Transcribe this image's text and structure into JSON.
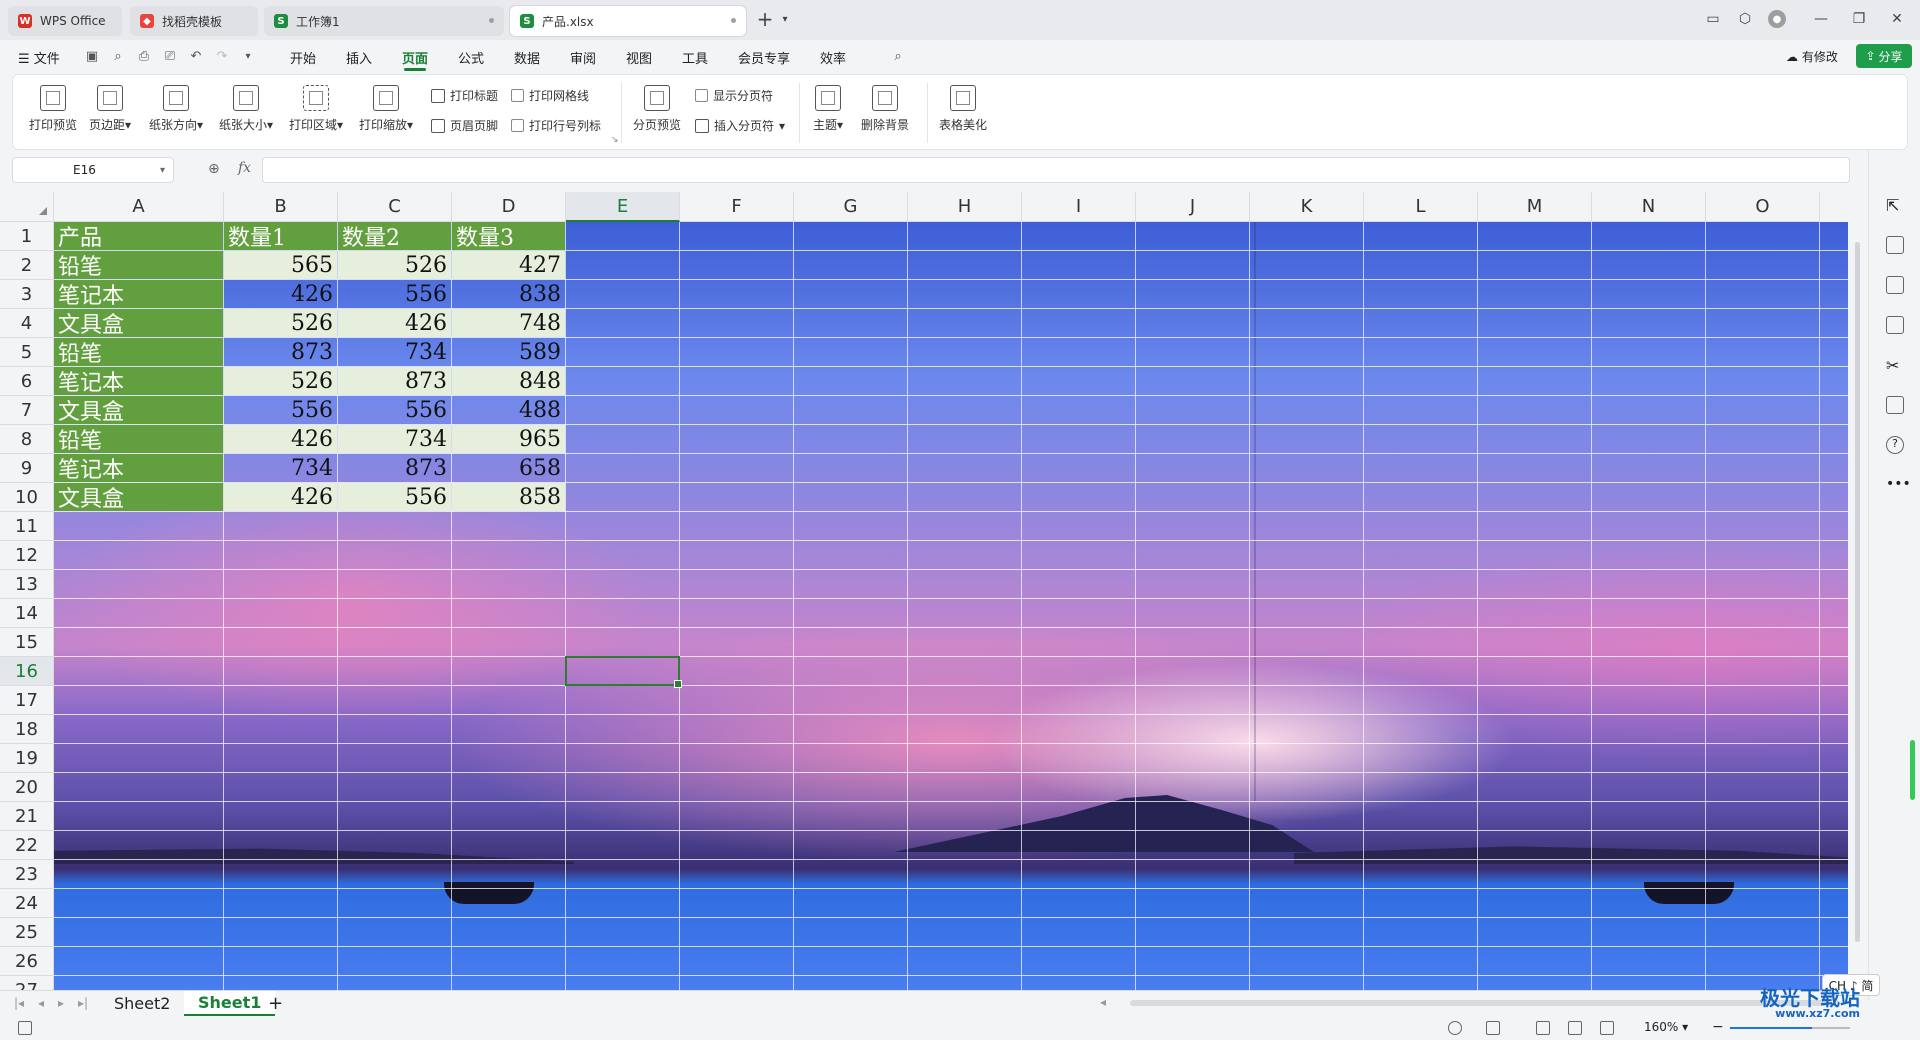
{
  "tabs": [
    {
      "label": "WPS Office",
      "icon": "wps-logo-icon",
      "color": "#d93025"
    },
    {
      "label": "找稻壳模板",
      "icon": "docer-icon",
      "color": "#e8453c"
    },
    {
      "label": "工作簿1",
      "icon": "spreadsheet-icon",
      "color": "#1e8e3e"
    },
    {
      "label": "产品.xlsx",
      "icon": "spreadsheet-icon",
      "color": "#1e8e3e"
    }
  ],
  "new_tab_label": "+",
  "menu": {
    "file": "文件",
    "items": [
      "开始",
      "插入",
      "页面",
      "公式",
      "数据",
      "审阅",
      "视图",
      "工具",
      "会员专享",
      "效率"
    ],
    "active": "页面",
    "modified": "有修改",
    "share": "分享"
  },
  "ribbon": {
    "large": [
      "打印预览",
      "页边距",
      "纸张方向",
      "纸张大小",
      "打印区域",
      "打印缩放"
    ],
    "small_col1": [
      "打印标题",
      "页眉页脚"
    ],
    "small_col2": [
      "打印网格线",
      "打印行号列标"
    ],
    "large2": [
      "分页预览"
    ],
    "small_col3": [
      "显示分页符",
      "插入分页符"
    ],
    "large3": [
      "主题",
      "删除背景"
    ],
    "large4": [
      "表格美化"
    ]
  },
  "namebox": "E16",
  "fx": "fx",
  "columns": [
    "A",
    "B",
    "C",
    "D",
    "E",
    "F",
    "G",
    "H",
    "I",
    "J",
    "K",
    "L",
    "M",
    "N",
    "O"
  ],
  "rows": [
    "1",
    "2",
    "3",
    "4",
    "5",
    "6",
    "7",
    "8",
    "9",
    "10",
    "11",
    "12",
    "13",
    "14",
    "15",
    "16",
    "17",
    "18",
    "19",
    "20",
    "21",
    "22",
    "23",
    "24",
    "25",
    "26",
    "27"
  ],
  "selected_cell": {
    "col": "E",
    "row": "16"
  },
  "table": {
    "header": [
      "产品",
      "数量1",
      "数量2",
      "数量3"
    ],
    "rows": [
      [
        "铅笔",
        "565",
        "526",
        "427"
      ],
      [
        "笔记本",
        "426",
        "556",
        "838"
      ],
      [
        "文具盒",
        "526",
        "426",
        "748"
      ],
      [
        "铅笔",
        "873",
        "734",
        "589"
      ],
      [
        "笔记本",
        "526",
        "873",
        "848"
      ],
      [
        "文具盒",
        "556",
        "556",
        "488"
      ],
      [
        "铅笔",
        "426",
        "734",
        "965"
      ],
      [
        "笔记本",
        "734",
        "873",
        "658"
      ],
      [
        "文具盒",
        "426",
        "556",
        "858"
      ]
    ]
  },
  "sheets": [
    "Sheet2",
    "Sheet1"
  ],
  "active_sheet": "Sheet1",
  "add_sheet": "+",
  "zoom": "160%",
  "ime": "CH ♪ 简",
  "watermark": {
    "main": "极光下载站",
    "sub": "www.xz7.com"
  },
  "colors": {
    "accent": "#1a7f37",
    "header_fill": "#62a03f",
    "light_fill": "#e5efdc"
  }
}
